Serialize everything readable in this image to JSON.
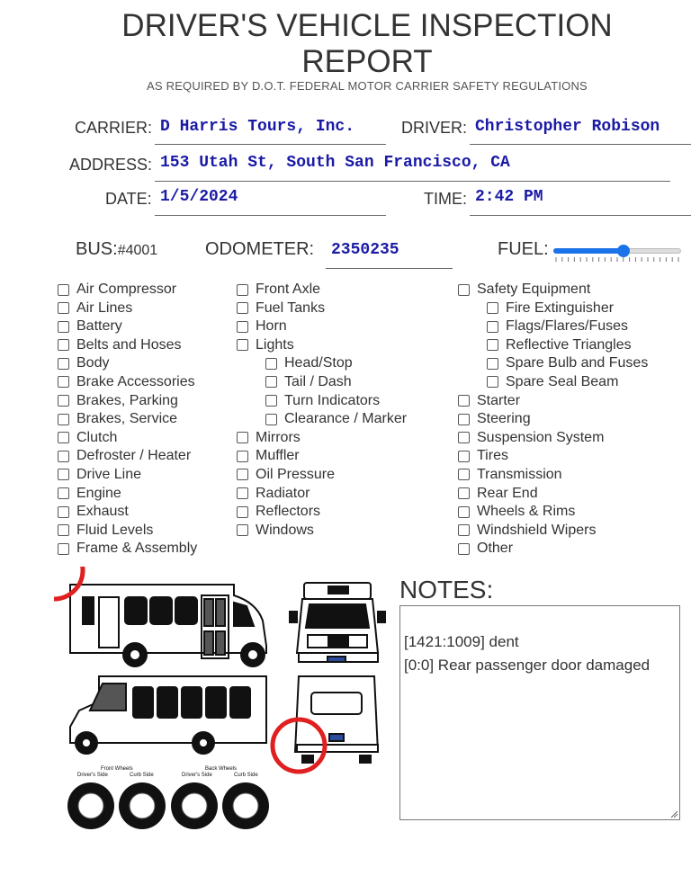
{
  "header": {
    "title_line1": "DRIVER'S VEHICLE INSPECTION",
    "title_line2": "REPORT",
    "subtitle": "AS REQUIRED BY D.O.T. FEDERAL MOTOR CARRIER SAFETY REGULATIONS"
  },
  "form": {
    "carrier_label": "CARRIER:",
    "carrier_value": "D Harris Tours, Inc.",
    "driver_label": "DRIVER:",
    "driver_value": "Christopher Robison",
    "address_label": "ADDRESS:",
    "address_value": "153 Utah St, South San Francisco, CA",
    "date_label": "DATE:",
    "date_value": "1/5/2024",
    "time_label": "TIME:",
    "time_value": "2:42 PM",
    "bus_label": "BUS:",
    "bus_value": "#4001",
    "odometer_label": "ODOMETER:",
    "odometer_value": "2350235",
    "fuel_label": "FUEL:",
    "fuel_level_fraction": 0.55
  },
  "checklist": {
    "col1": [
      "Air Compressor",
      "Air Lines",
      "Battery",
      "Belts and Hoses",
      "Body",
      "Brake Accessories",
      "Brakes, Parking",
      "Brakes, Service",
      "Clutch",
      "Defroster / Heater",
      "Drive Line",
      "Engine",
      "Exhaust",
      "Fluid Levels",
      "Frame & Assembly"
    ],
    "col2": [
      "Front Axle",
      "Fuel Tanks",
      "Horn",
      "Lights",
      "Head/Stop",
      "Tail / Dash",
      "Turn Indicators",
      "Clearance / Marker",
      "Mirrors",
      "Muffler",
      "Oil Pressure",
      "Radiator",
      "Reflectors",
      "Windows"
    ],
    "col3": [
      "Safety Equipment",
      "Fire Extinguisher",
      "Flags/Flares/Fuses",
      "Reflective Triangles",
      "Spare Bulb and Fuses",
      "Spare Seal Beam",
      "Starter",
      "Steering",
      "Suspension System",
      "Tires",
      "Transmission",
      "Rear End",
      "Wheels & Rims",
      "Windshield Wipers",
      "Other"
    ]
  },
  "diagram": {
    "front_wheels_label": "Front Wheels",
    "back_wheels_label": "Back Wheels",
    "drivers_side_label": "Driver's Side",
    "curb_side_label": "Curb Side",
    "marker_color": "#e02020"
  },
  "notes": {
    "heading": "NOTES:",
    "lines": [
      "[1421:1009] dent",
      "[0:0] Rear passenger door damaged"
    ]
  },
  "colors": {
    "value_text": "#1a1aa6",
    "slider_accent": "#1a73e8"
  }
}
